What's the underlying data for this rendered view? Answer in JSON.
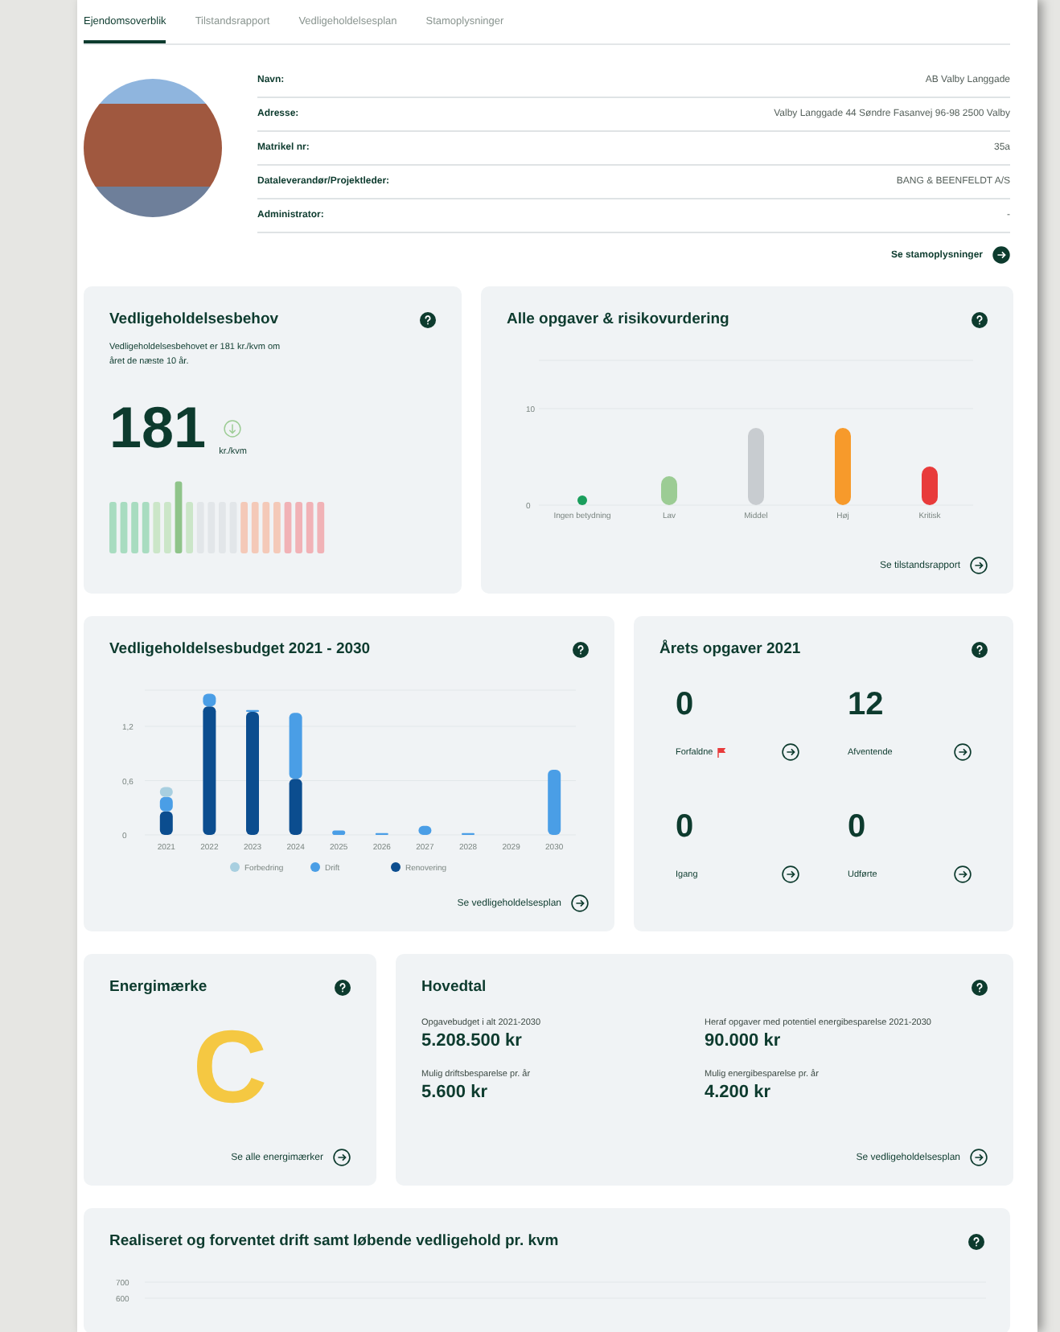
{
  "tabs": [
    {
      "label": "Ejendomsoverblik",
      "selected": true
    },
    {
      "label": "Tilstandsrapport",
      "selected": false
    },
    {
      "label": "Vedligeholdelsesplan",
      "selected": false
    },
    {
      "label": "Stamoplysninger",
      "selected": false
    }
  ],
  "property": {
    "fields": [
      {
        "label": "Navn:",
        "value": "AB Valby Langgade"
      },
      {
        "label": "Adresse:",
        "value": "Valby Langgade 44 Søndre Fasanvej 96-98 2500 Valby"
      },
      {
        "label": "Matrikel nr:",
        "value": "35a"
      },
      {
        "label": "Dataleverandør/Projektleder:",
        "value": "BANG & BEENFELDT A/S"
      },
      {
        "label": "Administrator:",
        "value": "-"
      }
    ],
    "link": "Se stamoplysninger"
  },
  "maintenance_need": {
    "title": "Vedligeholdelsesbehov",
    "description": "Vedligeholdelsesbehovet er 181 kr./kvm om året de næste 10 år.",
    "value": "181",
    "unit": "kr./kvm"
  },
  "risk": {
    "title": "Alle opgaver & risikovurdering",
    "link": "Se tilstandsrapport",
    "chart_data": {
      "type": "bar",
      "categories": [
        "Ingen betydning",
        "Lav",
        "Middel",
        "Høj",
        "Kritisk"
      ],
      "values": [
        1,
        3,
        8,
        8,
        4
      ],
      "colors": [
        "#1a9e5c",
        "#9ccc94",
        "#c8ccd0",
        "#f79a2b",
        "#e83b3b"
      ],
      "yticks": [
        0,
        10
      ],
      "ylim": [
        0,
        15
      ]
    }
  },
  "budget": {
    "title": "Vedligeholdelsesbudget 2021 - 2030",
    "link": "Se vedligeholdelsesplan",
    "chart_data": {
      "type": "bar",
      "stacked": true,
      "categories": [
        "2021",
        "2022",
        "2023",
        "2024",
        "2025",
        "2026",
        "2027",
        "2028",
        "2029",
        "2030"
      ],
      "series": [
        {
          "name": "Renovering",
          "color": "#0b4d8f",
          "values": [
            0.26,
            1.42,
            1.36,
            0.62,
            0,
            0,
            0,
            0,
            0,
            0
          ]
        },
        {
          "name": "Drift",
          "color": "#4a9ee6",
          "values": [
            0.16,
            0.14,
            0.02,
            0.73,
            0.05,
            0.02,
            0.1,
            0.02,
            0,
            0.72
          ]
        },
        {
          "name": "Forbedring",
          "color": "#a8cfe0",
          "values": [
            0.11,
            0,
            0,
            0,
            0,
            0,
            0,
            0,
            0,
            0
          ]
        }
      ],
      "yticks": [
        0,
        {
          "value": 0.6,
          "label": "0,6"
        },
        {
          "value": 1.2,
          "label": "1,2"
        }
      ],
      "ylim": [
        0,
        1.6
      ],
      "legend": "bottom"
    }
  },
  "tasks": {
    "title": "Årets opgaver 2021",
    "items": [
      {
        "count": "0",
        "label": "Forfaldne",
        "flagged": true
      },
      {
        "count": "12",
        "label": "Afventende",
        "flagged": false
      },
      {
        "count": "0",
        "label": "Igang",
        "flagged": false
      },
      {
        "count": "0",
        "label": "Udførte",
        "flagged": false
      }
    ]
  },
  "energy": {
    "title": "Energimærke",
    "grade": "C",
    "link": "Se alle energimærker"
  },
  "key_figures": {
    "title": "Hovedtal",
    "items": [
      {
        "label": "Opgavebudget i alt 2021-2030",
        "value": "5.208.500 kr"
      },
      {
        "label": "Heraf opgaver med potentiel energibesparelse 2021-2030",
        "value": "90.000 kr"
      },
      {
        "label": "Mulig driftsbesparelse pr. år",
        "value": "5.600 kr"
      },
      {
        "label": "Mulig energibesparelse pr. år",
        "value": "4.200 kr"
      }
    ],
    "link": "Se vedligeholdelsesplan"
  },
  "operations": {
    "title": "Realiseret og forventet drift samt løbende vedligehold pr. kvm",
    "y_axis_labels": [
      "700",
      "600"
    ]
  }
}
